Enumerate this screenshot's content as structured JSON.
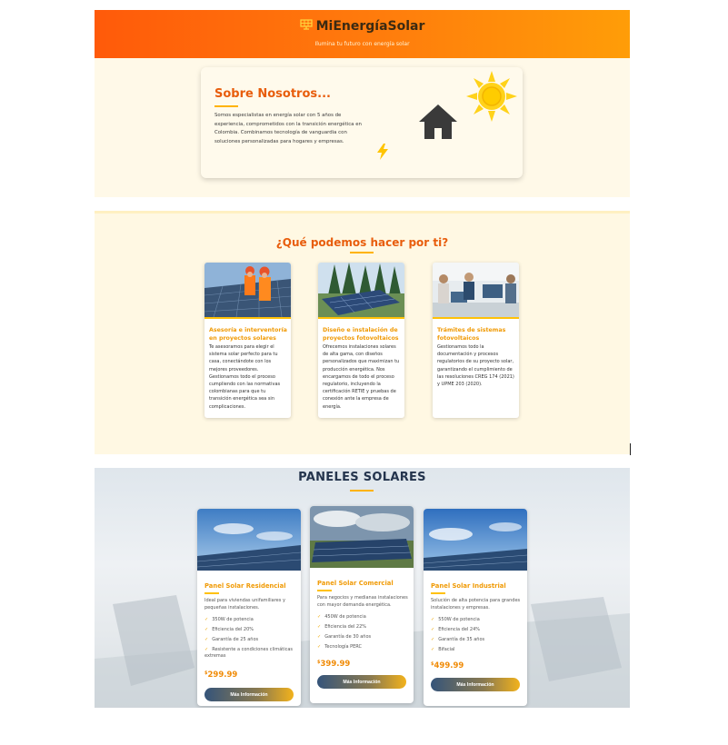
{
  "header": {
    "brand": "MiEnergíaSolar",
    "tagline": "Ilumina tu futuro con energía solar",
    "icon": "solar-panel-icon"
  },
  "about": {
    "title": "Sobre Nosotros...",
    "text": "Somos especialistas en energía solar con 5 años de experiencia, comprometidos con la transición energética en Colombia. Combinamos tecnología de vanguardia con soluciones personalizadas para hogares y empresas.",
    "icons": [
      "house-icon",
      "sun-icon",
      "lightning-icon"
    ]
  },
  "services": {
    "title": "¿Qué podemos hacer por ti?",
    "items": [
      {
        "title": "Asesoría e interventoría en proyectos solares",
        "text": "Te asesoramos para elegir el sistema solar perfecto para tu casa, conectándote con los mejores proveedores. Gestionamos todo el proceso cumpliendo con las normativas colombianas para que tu transición energética sea sin complicaciones."
      },
      {
        "title": "Diseño e instalación de proyectos fotovoltaicos",
        "text": "Ofrecemos instalaciones solares de alta gama, con diseños personalizados que maximizan tu producción energética. Nos encargamos de todo el proceso regulatorio, incluyendo la certificación RETIE y pruebas de conexión ante la empresa de energía."
      },
      {
        "title": "Trámites de sistemas fotovoltaicos",
        "text": "Gestionamos todo la documentación y procesos regulatorios de su proyecto solar, garantizando el cumplimiento de las resoluciones CREG 174 (2021) y UPME 203 (2020)."
      }
    ]
  },
  "panels": {
    "title": "PANELES SOLARES",
    "items": [
      {
        "name": "Panel Solar Residencial",
        "desc": "Ideal para viviendas unifamiliares y pequeñas instalaciones.",
        "features": [
          "350W de potencia",
          "Eficiencia del 20%",
          "Garantía de 25 años",
          "Resistente a condiciones climáticas extremas"
        ],
        "currency": "$",
        "price": "299.99",
        "button": "Más Información"
      },
      {
        "name": "Panel Solar Comercial",
        "desc": "Para negocios y medianas instalaciones con mayor demanda energética.",
        "features": [
          "450W de potencia",
          "Eficiencia del 22%",
          "Garantía de 30 años",
          "Tecnología PERC"
        ],
        "currency": "$",
        "price": "399.99",
        "button": "Más Información"
      },
      {
        "name": "Panel Solar Industrial",
        "desc": "Solución de alta potencia para grandes instalaciones y empresas.",
        "features": [
          "550W de potencia",
          "Eficiencia del 24%",
          "Garantía de 35 años",
          "Bifacial"
        ],
        "currency": "$",
        "price": "499.99",
        "button": "Más Información"
      }
    ]
  },
  "colors": {
    "header_start": "#ff5a0a",
    "header_end": "#ff9d08",
    "accent": "#f09a05",
    "title_orange": "#e85d0c",
    "navy": "#24344d"
  }
}
